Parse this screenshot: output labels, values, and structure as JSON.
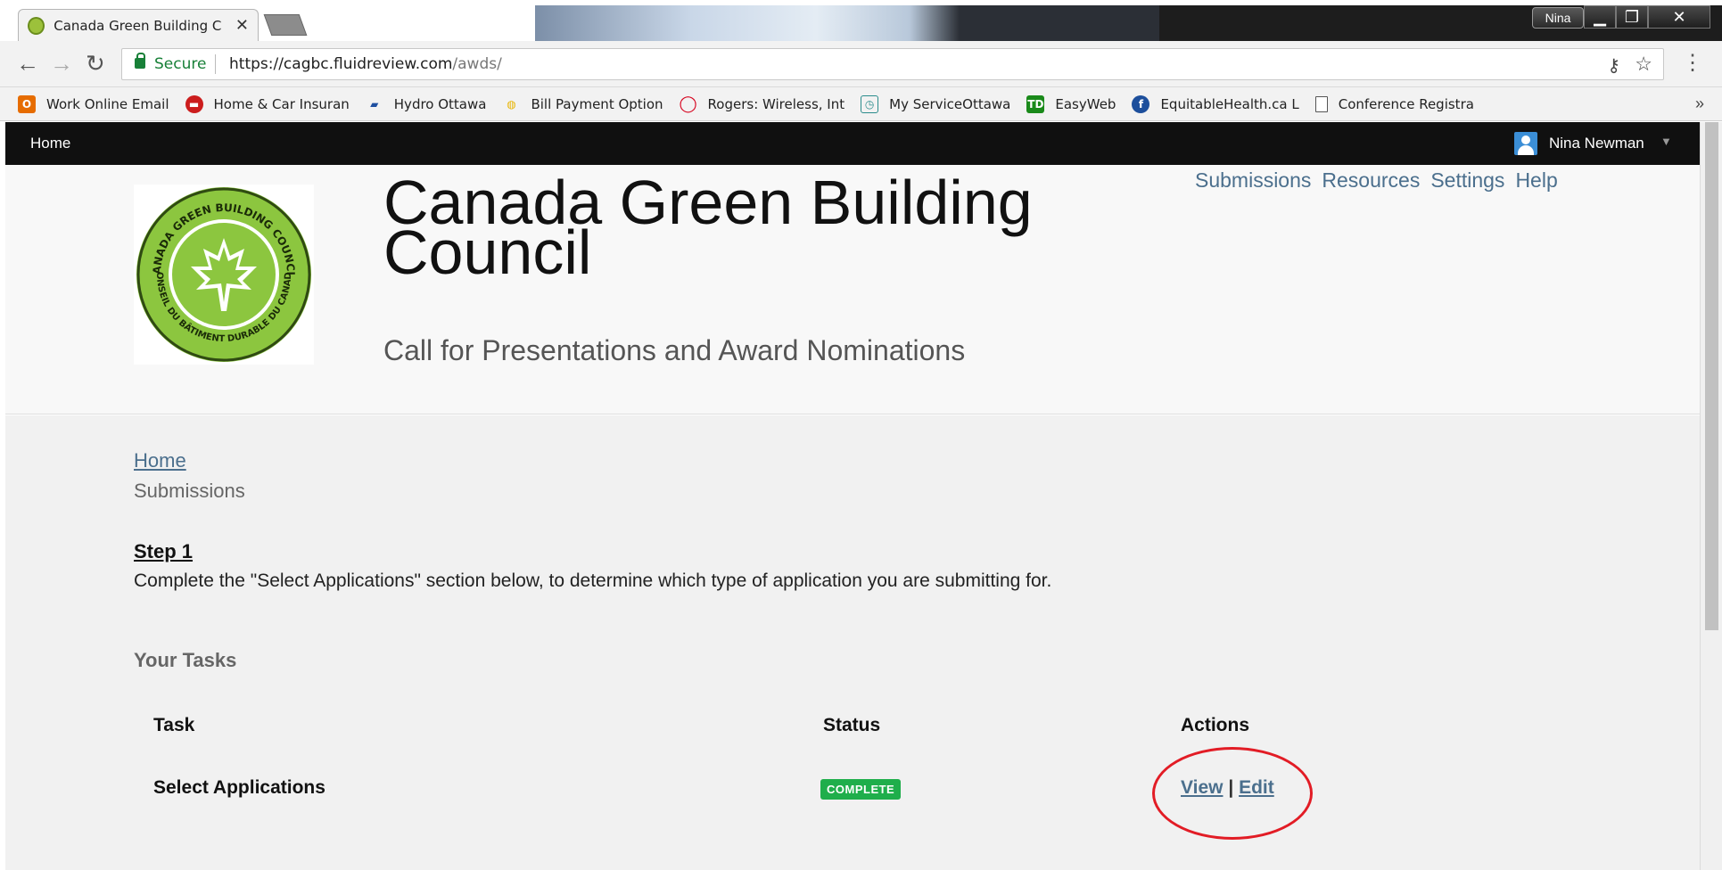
{
  "browser": {
    "tab_title": "Canada Green Building C",
    "window_user": "Nina",
    "secure_label": "Secure",
    "url_host": "https://cagbc.fluidreview.com",
    "url_path": "/awds/",
    "bookmarks": [
      {
        "label": "Work Online Email",
        "icon": "office-icon",
        "color": "#e66c00"
      },
      {
        "label": "Home & Car Insuran",
        "icon": "car-icon",
        "color": "#cc1d1d"
      },
      {
        "label": "Hydro Ottawa",
        "icon": "hydro-icon",
        "color": "#1f4fa0"
      },
      {
        "label": "Bill Payment Option",
        "icon": "bill-icon",
        "color": "#e8b400"
      },
      {
        "label": "Rogers: Wireless, Int",
        "icon": "rogers-icon",
        "color": "#d6001c"
      },
      {
        "label": "My ServiceOttawa",
        "icon": "ottawa-icon",
        "color": "#2a8c8c"
      },
      {
        "label": "EasyWeb",
        "icon": "td-icon",
        "color": "#1a8a1a"
      },
      {
        "label": "EquitableHealth.ca L",
        "icon": "equitable-icon",
        "color": "#1d4f9c"
      },
      {
        "label": "Conference Registra",
        "icon": "page-icon",
        "color": "#ffffff"
      }
    ]
  },
  "site": {
    "nav_home": "Home",
    "user_name": "Nina Newman",
    "title": "Canada Green Building Council",
    "subtitle": "Call for Presentations and Award Nominations",
    "topnav": [
      "Submissions",
      "Resources",
      "Settings",
      "Help"
    ],
    "logo_text_top": "CANADA GREEN BUILDING COUNCIL",
    "logo_text_bottom": "CONSEIL DU BÂTIMENT DURABLE DU CANADA"
  },
  "content": {
    "breadcrumb_home": "Home",
    "breadcrumb_current": "Submissions",
    "step_title": "Step 1",
    "step_desc": "Complete the \"Select Applications\" section below, to determine which type of application you are submitting for.",
    "tasks_heading": "Your Tasks",
    "columns": [
      "Task",
      "Status",
      "Actions"
    ],
    "rows": [
      {
        "task": "Select Applications",
        "status": "COMPLETE",
        "view": "View",
        "sep": "|",
        "edit": "Edit"
      }
    ]
  },
  "colors": {
    "accent_link": "#4b6f8d",
    "status_complete": "#1fae4b",
    "annotation": "#e21c25",
    "logo_green": "#8cc63f"
  }
}
